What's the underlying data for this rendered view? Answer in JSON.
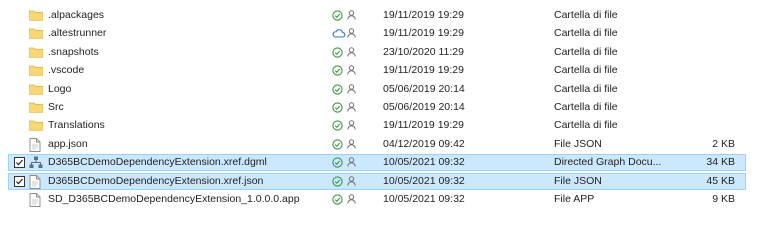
{
  "rows": [
    {
      "name": ".alpackages",
      "icon": "folder-icon",
      "sync": "synced",
      "date": "19/11/2019 19:29",
      "type": "Cartella di file",
      "size": "",
      "selected": false
    },
    {
      "name": ".altestrunner",
      "icon": "folder-icon",
      "sync": "cloud",
      "date": "19/11/2019 19:29",
      "type": "Cartella di file",
      "size": "",
      "selected": false
    },
    {
      "name": ".snapshots",
      "icon": "folder-icon",
      "sync": "synced",
      "date": "23/10/2020 11:29",
      "type": "Cartella di file",
      "size": "",
      "selected": false
    },
    {
      "name": ".vscode",
      "icon": "folder-icon",
      "sync": "synced",
      "date": "19/11/2019 19:29",
      "type": "Cartella di file",
      "size": "",
      "selected": false
    },
    {
      "name": "Logo",
      "icon": "folder-icon",
      "sync": "synced",
      "date": "05/06/2019 20:14",
      "type": "Cartella di file",
      "size": "",
      "selected": false
    },
    {
      "name": "Src",
      "icon": "folder-icon",
      "sync": "synced",
      "date": "05/06/2019 20:14",
      "type": "Cartella di file",
      "size": "",
      "selected": false
    },
    {
      "name": "Translations",
      "icon": "folder-icon",
      "sync": "synced",
      "date": "19/11/2019 19:29",
      "type": "Cartella di file",
      "size": "",
      "selected": false
    },
    {
      "name": "app.json",
      "icon": "file-icon",
      "sync": "synced",
      "date": "04/12/2019 09:42",
      "type": "File JSON",
      "size": "2 KB",
      "selected": false
    },
    {
      "name": "D365BCDemoDependencyExtension.xref.dgml",
      "icon": "graph-file-icon",
      "sync": "synced",
      "date": "10/05/2021 09:32",
      "type": "Directed Graph Docu...",
      "size": "34 KB",
      "selected": true
    },
    {
      "name": "D365BCDemoDependencyExtension.xref.json",
      "icon": "file-icon",
      "sync": "synced",
      "date": "10/05/2021 09:32",
      "type": "File JSON",
      "size": "45 KB",
      "selected": true
    },
    {
      "name": "SD_D365BCDemoDependencyExtension_1.0.0.0.app",
      "icon": "file-icon",
      "sync": "synced",
      "date": "10/05/2021 09:32",
      "type": "File APP",
      "size": "9 KB",
      "selected": false
    }
  ],
  "colors": {
    "folder": "#f8d775",
    "folder_dark": "#e0b040",
    "synced": "#3a9a3a",
    "cloud": "#2c7bd1",
    "person": "#6f6f6f",
    "selected_bg": "#cce8ff"
  }
}
